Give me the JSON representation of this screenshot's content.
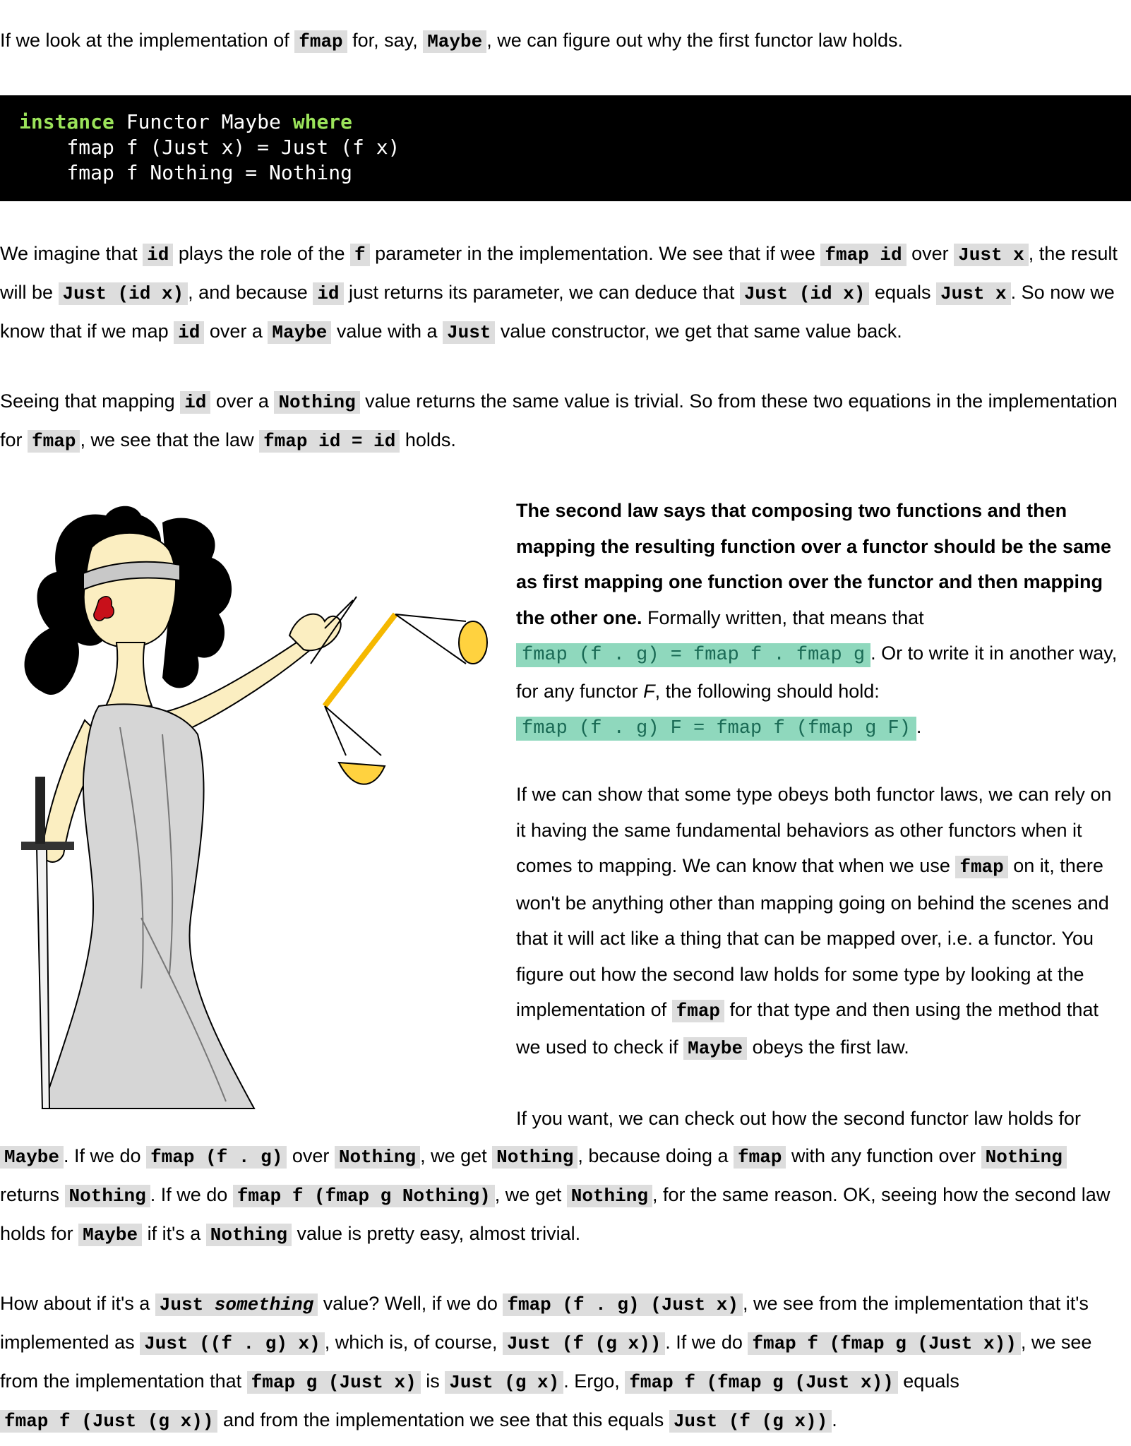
{
  "intro": {
    "t1": "If we look at the implementation of ",
    "c1": "fmap",
    "t2": " for, say, ",
    "c2": "Maybe",
    "t3": ", we can figure out why the first functor law holds."
  },
  "code_block": {
    "l1_kw1": "instance",
    "l1_mid": " Functor Maybe ",
    "l1_kw2": "where",
    "l2": "    fmap f (Just x) = Just (f x)",
    "l3": "    fmap f Nothing = Nothing"
  },
  "para1": {
    "t1": "We imagine that ",
    "c1": "id",
    "t2": " plays the role of the ",
    "c2": "f",
    "t3": " parameter in the implementation. We see that if wee ",
    "c3": "fmap id",
    "t4": " over ",
    "c4": "Just x",
    "t5": ", the result will be ",
    "c5": "Just (id x)",
    "t6": ", and because ",
    "c6": "id",
    "t7": " just returns its parameter, we can deduce that ",
    "c7": "Just (id x)",
    "t8": " equals ",
    "c8": "Just x",
    "t9": ". So now we know that if we map ",
    "c9": "id",
    "t10": " over a ",
    "c10": "Maybe",
    "t11": " value with a ",
    "c11": "Just",
    "t12": " value constructor, we get that same value back."
  },
  "para2": {
    "t1": "Seeing that mapping ",
    "c1": "id",
    "t2": " over a ",
    "c2": "Nothing",
    "t3": " value returns the same value is trivial. So from these two equations in the implementation for ",
    "c3": "fmap",
    "t4": ", we see that the law ",
    "c4": "fmap id = id",
    "t5": " holds."
  },
  "para3": {
    "bold": "The second law says that composing two functions and then mapping the resulting function over a functor should be the same as first mapping one function over the functor and then mapping the other one.",
    "t1": " Formally written, that means that ",
    "h1": "fmap (f . g) = fmap f . fmap g",
    "t2": ". Or to write it in another way, for any functor ",
    "i1": "F",
    "t3": ", the following should hold: ",
    "h2": "fmap (f . g) F = fmap f (fmap g F)",
    "t4": "."
  },
  "para4": {
    "t1": "If we can show that some type obeys both functor laws, we can rely on it having the same fundamental behaviors as other functors when it comes to mapping. We can know that when we use ",
    "c1": "fmap",
    "t2": " on it, there won't be anything other than mapping going on behind the scenes and that it will act like a thing that can be mapped over, i.e. a functor. You figure out how the second law holds for some type by looking at the implementation of ",
    "c2": "fmap",
    "t3": " for that type and then using the method that we used to check if ",
    "c3": "Maybe",
    "t4": " obeys the first law."
  },
  "para5": {
    "first_line": "If you want, we can check out how the second functor law holds for",
    "c1": "Maybe",
    "t1": ". If we do ",
    "c2": "fmap (f . g)",
    "t2": " over ",
    "c3": "Nothing",
    "t3": ", we get ",
    "c4": "Nothing",
    "t4": ", because doing a ",
    "c5": "fmap",
    "t5": " with any function over ",
    "c6": "Nothing",
    "t6": " returns ",
    "c7": "Nothing",
    "t7": ". If we do ",
    "c8": "fmap f (fmap g Nothing)",
    "t8": ", we get ",
    "c9": "Nothing",
    "t9": ", for the same reason. OK, seeing how the second law holds for ",
    "c10": "Maybe",
    "t10": " if it's a ",
    "c11": "Nothing",
    "t11": " value is pretty easy, almost trivial."
  },
  "para6": {
    "t1": "How about if it's a ",
    "c1a": "Just ",
    "c1b": "something",
    "t2": " value? Well, if we do ",
    "c2": "fmap (f . g) (Just x)",
    "t3": ", we see from the implementation that it's implemented as ",
    "c3": "Just ((f . g) x)",
    "t4": ", which is, of course, ",
    "c4": "Just (f (g x))",
    "t5": ". If we do ",
    "c5": "fmap f (fmap g (Just x))",
    "t6": ", we see from the implementation that ",
    "c6": "fmap g (Just x)",
    "t7": " is ",
    "c7": "Just (g x)",
    "t8": ". Ergo, ",
    "c8": "fmap f (fmap g (Just x))",
    "t9": " equals ",
    "c9": "fmap f (Just (g x))",
    "t10": " and from the implementation we see that this equals ",
    "c10": "Just (f (g x))",
    "t11": "."
  },
  "colors": {
    "code_bg": "#000000",
    "keyword": "#9be35a",
    "inline_code_bg": "#dddddd",
    "highlight_bg": "#8fd8bd",
    "highlight_text": "#1a6a55"
  },
  "icons": [
    "lady-justice-illustration"
  ]
}
